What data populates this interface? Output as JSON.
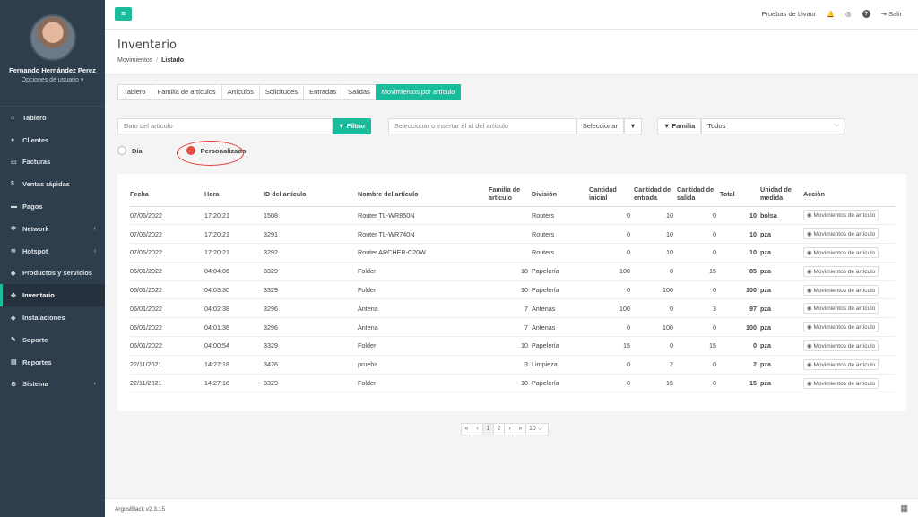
{
  "user": {
    "name": "Fernando Hernández Perez",
    "options": "Opciones de usuario"
  },
  "nav": [
    {
      "icon": "tablero-icon",
      "glyph": "⌂",
      "label": "Tablero"
    },
    {
      "icon": "clientes-icon",
      "glyph": "●",
      "label": "Clientes"
    },
    {
      "icon": "facturas-icon",
      "glyph": "▭",
      "label": "Facturas"
    },
    {
      "icon": "dollar-icon",
      "glyph": "$",
      "label": "Ventas rápidas"
    },
    {
      "icon": "pagos-icon",
      "glyph": "▬",
      "label": "Pagos"
    },
    {
      "icon": "network-icon",
      "glyph": "✲",
      "label": "Network",
      "caret": "‹"
    },
    {
      "icon": "wifi-icon",
      "glyph": "≋",
      "label": "Hotspot",
      "caret": "‹"
    },
    {
      "icon": "tag-icon",
      "glyph": "◆",
      "label": "Productos y servicios"
    },
    {
      "icon": "cubes-icon",
      "glyph": "✤",
      "label": "Inventario",
      "active": true
    },
    {
      "icon": "install-icon",
      "glyph": "◈",
      "label": "Instalaciones"
    },
    {
      "icon": "wrench-icon",
      "glyph": "✎",
      "label": "Soporte"
    },
    {
      "icon": "book-icon",
      "glyph": "▤",
      "label": "Reportes"
    },
    {
      "icon": "cogs-icon",
      "glyph": "⚙",
      "label": "Sistema",
      "caret": "‹"
    }
  ],
  "topbar": {
    "company": "Pruebas de Livaur",
    "logout": "Salir",
    "menu_glyph": "≡",
    "bell": "🔔",
    "globe": "◎",
    "help": "?",
    "exit_glyph": "⇥"
  },
  "header": {
    "title": "Inventario",
    "crumb1": "Movimientos",
    "sep": "/",
    "crumb2": "Listado"
  },
  "tabs": [
    "Tablero",
    "Familia de artículos",
    "Artículos",
    "Solicitudes",
    "Entradas",
    "Salidas",
    "Movimientos por artículo"
  ],
  "filters": {
    "article_placeholder": "Dato del artículo",
    "filter_btn": "Filtrar",
    "id_placeholder": "Seleccionar o insertar él id del artículo",
    "select_btn": "Seleccionar",
    "familia_label": "Familia",
    "familia_value": "Todos",
    "funnel": "▼",
    "chevron": "⌵"
  },
  "radios": {
    "dia": "Día",
    "personalizado": "Personalizado"
  },
  "table": {
    "headers": [
      "Fecha",
      "Hora",
      "ID del artículo",
      "Nombre del artículo",
      "Familia de artículo",
      "División",
      "Cantidad inicial",
      "Cantidad de entrada",
      "Cantidad de salida",
      "Total",
      "Unidad de medida",
      "Acción"
    ],
    "action_label": "Movimientos de artículo",
    "rows": [
      [
        "07/06/2022",
        "17:20:21",
        "1508",
        "Router TL-WR850N",
        "",
        "Routers",
        "0",
        "10",
        "0",
        "10",
        "bolsa"
      ],
      [
        "07/06/2022",
        "17:20:21",
        "3291",
        "Router TL-WR740N",
        "",
        "Routers",
        "0",
        "10",
        "0",
        "10",
        "pza"
      ],
      [
        "07/06/2022",
        "17:20:21",
        "3292",
        "Router ARCHER-C20W",
        "",
        "Routers",
        "0",
        "10",
        "0",
        "10",
        "pza"
      ],
      [
        "06/01/2022",
        "04:04:06",
        "3329",
        "Folder",
        "10",
        "Papelería",
        "100",
        "0",
        "15",
        "85",
        "pza"
      ],
      [
        "06/01/2022",
        "04:03:30",
        "3329",
        "Folder",
        "10",
        "Papelería",
        "0",
        "100",
        "0",
        "100",
        "pza"
      ],
      [
        "06/01/2022",
        "04:02:38",
        "3296",
        "Antena",
        "7",
        "Antenas",
        "100",
        "0",
        "3",
        "97",
        "pza"
      ],
      [
        "06/01/2022",
        "04:01:36",
        "3296",
        "Antena",
        "7",
        "Antenas",
        "0",
        "100",
        "0",
        "100",
        "pza"
      ],
      [
        "06/01/2022",
        "04:00:54",
        "3329",
        "Folder",
        "10",
        "Papelería",
        "15",
        "0",
        "15",
        "0",
        "pza"
      ],
      [
        "22/11/2021",
        "14:27:18",
        "3426",
        "prueba",
        "3",
        "Limpieza",
        "0",
        "2",
        "0",
        "2",
        "pza"
      ],
      [
        "22/11/2021",
        "14:27:18",
        "3329",
        "Folder",
        "10",
        "Papelería",
        "0",
        "15",
        "0",
        "15",
        "pza"
      ]
    ]
  },
  "pager": {
    "first": "«",
    "prev": "‹",
    "p1": "1",
    "p2": "2",
    "next": "›",
    "last": "»",
    "size": "10"
  },
  "footer": {
    "version": "ArgusBlack v2.3.15",
    "icon": "▦"
  }
}
